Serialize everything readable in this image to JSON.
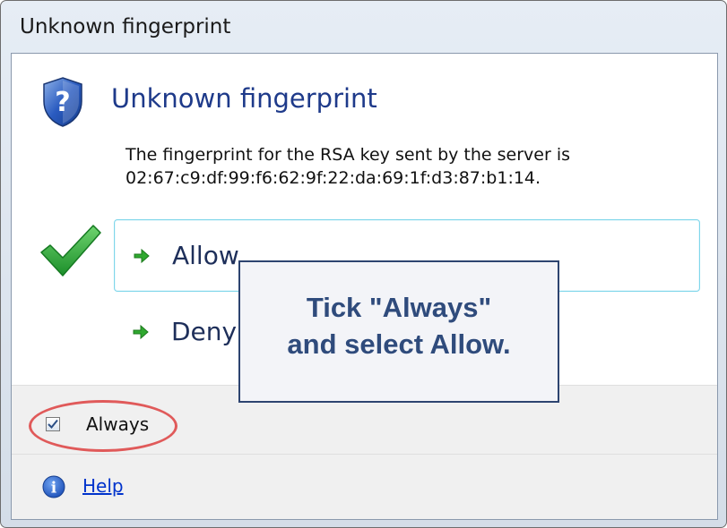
{
  "window": {
    "title": "Unknown fingerprint"
  },
  "dialog": {
    "heading": "Unknown fingerprint",
    "description_line1": "The fingerprint for the RSA key sent by the server is",
    "description_line2": "02:67:c9:df:99:f6:62:9f:22:da:69:1f:d3:87:b1:14.",
    "heading_icon": "shield-question-icon",
    "heading_color": "#1e3a8a"
  },
  "commands": {
    "allow_label": "Allow",
    "deny_label": "Deny",
    "arrow_icon": "green-arrow-icon",
    "check_icon": "green-checkmark-icon"
  },
  "footer": {
    "always_label": "Always",
    "always_checked": true,
    "help_label": "Help",
    "help_icon": "info-icon"
  },
  "annotation": {
    "line1": "Tick \"Always\"",
    "line2": "and select Allow.",
    "oval_color": "#e05a5a",
    "text_color": "#2f4b7c"
  }
}
